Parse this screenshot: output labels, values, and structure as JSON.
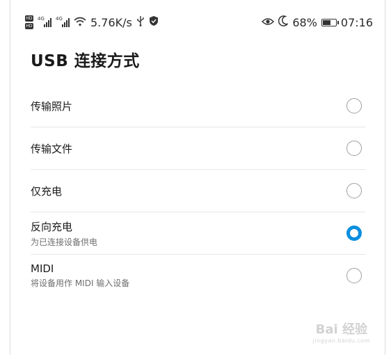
{
  "status_bar": {
    "hd_badges": [
      "HD",
      "HD"
    ],
    "sim1_tag": "4G",
    "sim2_tag": "4G",
    "net_speed": "5.76K/s",
    "battery": "68%",
    "battery_level": 0.68,
    "time": "07:16",
    "icons": [
      "signal-icon",
      "signal-icon",
      "wifi-icon",
      "usb-icon",
      "shield-icon",
      "eye-comfort-icon",
      "moon-icon",
      "battery-icon"
    ]
  },
  "page_title": "USB 连接方式",
  "options": [
    {
      "title": "传输照片",
      "subtitle": "",
      "selected": false
    },
    {
      "title": "传输文件",
      "subtitle": "",
      "selected": false
    },
    {
      "title": "仅充电",
      "subtitle": "",
      "selected": false
    },
    {
      "title": "反向充电",
      "subtitle": "为已连接设备供电",
      "selected": true
    },
    {
      "title": "MIDI",
      "subtitle": "将设备用作 MIDI 输入设备",
      "selected": false
    }
  ],
  "watermark": {
    "text": "Bai 经验",
    "url": "jingyan.baidu.com"
  },
  "colors": {
    "accent": "#0a8fe0",
    "divider": "#e6e6e6"
  }
}
